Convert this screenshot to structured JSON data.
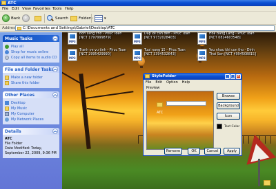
{
  "window": {
    "title": "ATC"
  },
  "menu": [
    "File",
    "Edit",
    "View",
    "Favorites",
    "Tools",
    "Help"
  ],
  "toolbar": {
    "back_label": "Back",
    "search_label": "Search",
    "folders_label": "Folders"
  },
  "address": {
    "label": "Address",
    "path": "C:\\Documents and Settings\\Gabriel\\Desktop\\ATC"
  },
  "tasks": {
    "music": {
      "title": "Music Tasks",
      "items": [
        "Play all",
        "Shop for music online",
        "Copy all items to audio CD"
      ]
    },
    "file_folder": {
      "title": "File and Folder Tasks",
      "items": [
        "Make a new folder",
        "Share this folder"
      ]
    },
    "other_places": {
      "title": "Other Places",
      "items": [
        "Desktop",
        "My Music",
        "My Computer",
        "My Network Places"
      ]
    },
    "details": {
      "title": "Details",
      "name": "ATC",
      "type": "File Folder",
      "modified": "Date Modified: Today, September 22, 2009, 9:36 PM"
    }
  },
  "files": [
    {
      "name": "Bon sang cho - Phuc Toan [NCT 1797999879]",
      "icon": "MP3"
    },
    {
      "name": "Dap xe can den - Phuc Toan [NCT 9732028403]",
      "icon": "MP3"
    },
    {
      "name": "Hoa Bang Lang - Phuc Toan [NCT 0824603548]",
      "icon": "MP3"
    },
    {
      "name": "Tranh ve vu tinh - Phuc Toan [NCT 2995429990]",
      "icon": "MP3"
    },
    {
      "name": "Tuoi nang 15 - Phuc Toan [NCT 3394532643]",
      "icon": "MP3"
    },
    {
      "name": "Yeu nhau khi con tho - Dinh Thai Son [NCT 4094508815]",
      "icon": "MP3"
    }
  ],
  "dialog": {
    "title": "StyleFolder",
    "menu": [
      "File",
      "Edit",
      "Option",
      "Help"
    ],
    "preview_label": "Preview",
    "preview_folder_name": "ATC",
    "side_buttons": [
      "Browse",
      "Background",
      "Icon"
    ],
    "text_color_label": "Text Color",
    "bottom_buttons": [
      "Remove",
      "OK",
      "Cancel",
      "Apply"
    ]
  }
}
